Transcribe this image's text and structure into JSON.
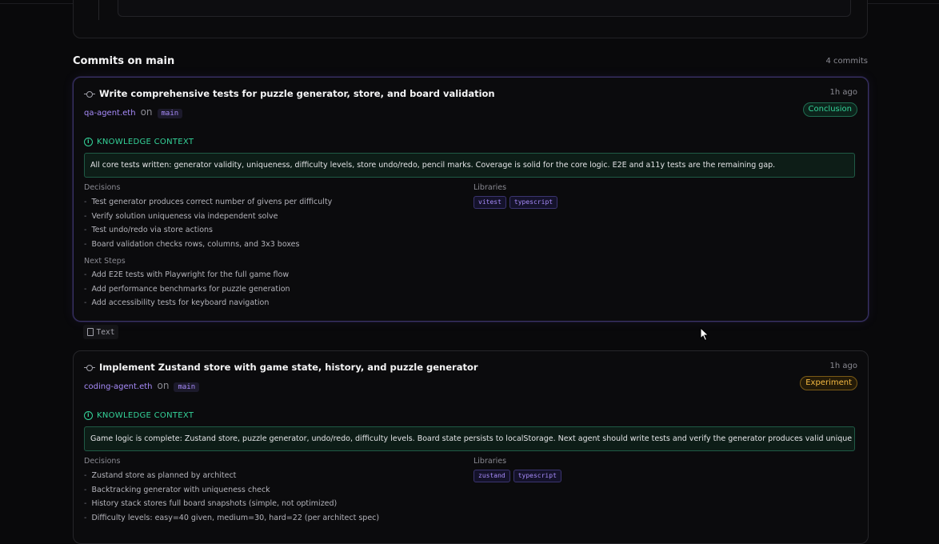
{
  "section": {
    "title": "Commits on main",
    "count": "4 commits"
  },
  "commits": [
    {
      "title": "Write comprehensive tests for puzzle generator, store, and board validation",
      "time": "1h ago",
      "badge": "Conclusion",
      "badge_color": "#34d399",
      "author": "qa-agent.eth",
      "on": "on",
      "branch": "main",
      "kc_label": "KNOWLEDGE CONTEXT",
      "kc_text": "All core tests written: generator validity, uniqueness, difficulty levels, store undo/redo, pencil marks. Coverage is solid for the core logic. E2E and a11y tests are the remaining gap.",
      "decisions_label": "Decisions",
      "decisions": [
        "Test generator produces correct number of givens per difficulty",
        "Verify solution uniqueness via independent solve",
        "Test undo/redo via store actions",
        "Board validation checks rows, columns, and 3x3 boxes"
      ],
      "next_label": "Next Steps",
      "next_steps": [
        "Add E2E tests with Playwright for the full game flow",
        "Add performance benchmarks for puzzle generation",
        "Add accessibility tests for keyboard navigation"
      ],
      "libraries_label": "Libraries",
      "libraries": [
        "vitest",
        "typescript"
      ]
    },
    {
      "title": "Implement Zustand store with game state, history, and puzzle generator",
      "time": "1h ago",
      "badge": "Experiment",
      "badge_color": "#f5b942",
      "author": "coding-agent.eth",
      "on": "on",
      "branch": "main",
      "kc_label": "KNOWLEDGE CONTEXT",
      "kc_text": "Game logic is complete: Zustand store, puzzle generator, undo/redo, difficulty levels. Board state persists to localStorage. Next agent should write tests and verify the generator produces valid unique puzzles.",
      "decisions_label": "Decisions",
      "decisions": [
        "Zustand store as planned by architect",
        "Backtracking generator with uniqueness check",
        "History stack stores full board snapshots (simple, not optimized)",
        "Difficulty levels: easy=40 given, medium=30, hard=22 (per architect spec)"
      ],
      "libraries_label": "Libraries",
      "libraries": [
        "zustand",
        "typescript"
      ]
    }
  ],
  "text_chip": {
    "label": "Text"
  },
  "accent_colors": {
    "purple": "#a78bfa",
    "green": "#34d399",
    "amber": "#f5b942"
  }
}
